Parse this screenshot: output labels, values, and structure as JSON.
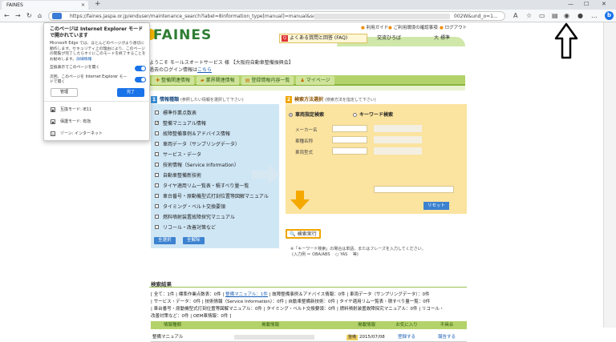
{
  "browser": {
    "tab_title": "FAINES",
    "tab_close": "✕",
    "new_tab": "+",
    "url": "https://faines.jaspa.or.jp/enduser/maintenance_search?label=8information_type[manual]=manual&select_",
    "url_tail": "002W&und_o=1...",
    "nav": {
      "back": "←",
      "forward": "→",
      "refresh": "↻",
      "home": "⌂"
    },
    "window": {
      "minimize": "—",
      "maximize": "☐",
      "close": "✕"
    },
    "edge_icon": "b"
  },
  "ie_popup": {
    "title": "このページは Internet Explorer モードで開かれています",
    "body": "Microsoft Edge では、ほとんどのページがより適切に動作します。セキュリティ上の理由により、このページの閲覧が完了したらすぐにこのモードを終了することをお勧めします。",
    "body_link": "詳細情報",
    "row1": "互換表示でこのページを開く",
    "row2": "次回、このページを Internet Explorer モードで開く",
    "manage_label": "管理",
    "done_label": "完了",
    "items": [
      {
        "label": "互換モード: IE11",
        "icon": "compat-icon"
      },
      {
        "label": "保護モード: 有効",
        "icon": "shield-icon"
      },
      {
        "label": "ゾーン: インターネット",
        "icon": "globe-icon"
      }
    ]
  },
  "site": {
    "logo": "FAINES",
    "top_links": [
      "利用ガイド",
      "ご利用環境の確認事項",
      "ログアウト"
    ],
    "faq": "よくある質問と回答 (FAQ)",
    "faq_icon": "Q",
    "koryu": "交流ひろば",
    "lang": "大",
    "lang2": "標準",
    "welcome": "ようこそ モールスオートサービス 様 【大阪府自動車整備振興会】",
    "login_prefix": "過去のログイン情報は",
    "login_link": "こちら",
    "nav_tabs": [
      "整備関連情報",
      "業界関連情報",
      "登録情報内容一覧",
      "マイページ"
    ]
  },
  "panel1": {
    "num": "1",
    "title": "情報種類",
    "sub": "(参照したい情報を選択して下さい)",
    "items": [
      {
        "label": "標準作業点数表",
        "checked": false
      },
      {
        "label": "整備マニュアル情報",
        "checked": true
      },
      {
        "label": "故障整備事例＆アドバイス情報",
        "checked": false
      },
      {
        "label": "車両データ（サンプリングデータ）",
        "checked": false
      },
      {
        "label": "サービス・データ",
        "checked": false
      },
      {
        "label": "技術情報（Service Information）",
        "checked": false
      },
      {
        "label": "自動車整備新技術",
        "checked": false
      },
      {
        "label": "タイヤ適用リム一覧表・積すべり量一覧",
        "checked": false
      },
      {
        "label": "車台番号・原動機型式打刻位置等図解マニュアル",
        "checked": false
      },
      {
        "label": "タイミング・ベルト交換要領",
        "checked": false
      },
      {
        "label": "燃料噴射装置故障探究マニュアル",
        "checked": false
      },
      {
        "label": "リコール・改善対策など",
        "checked": false
      }
    ],
    "select_all": "全選択",
    "deselect_all": "全解除"
  },
  "panel2": {
    "num": "2",
    "title": "検索方法選択",
    "sub": "(検索方法を指定して下さい)",
    "radio1": "車両指定検索",
    "radio2": "キーワード検索",
    "fields": [
      "メーカー名",
      "車種名称",
      "車両型式"
    ],
    "reset": "リセット"
  },
  "exec_label": "検索実行",
  "notes": [
    "※「キーワード検索」の場合は単語、またはフレーズを入力してください。",
    "(入力例 ＝ OBA/ABS 　○ YAS 　等)"
  ],
  "results": {
    "title": "検索結果",
    "line1_prefix": "[ 全て：1件 | 標準作業点数表：0件 | ",
    "line1_link": "整備マニュアル：1件",
    "line1_rest": " | 故障整備事例＆アドバイス情報：0件 | 車両データ（サンプリングデータ）：0件",
    "line2": "| サービス・データ：0件 | 技術情報（Service Information）：0件 | 自動車整備新技術：0件 | タイヤ適用リム一覧表・積すべり量一覧：0件",
    "line3": "| 車台番号・原動機型式打刻位置等図解マニュアル：0件 | タイミング・ベルト交換要領：0件 | 燃料噴射装置故障探究マニュアル：0件 | リコール・",
    "line4": "改善対策など：0件 | OEM車情報：0件 ]",
    "columns": [
      "情報種類",
      "掲載情報",
      "掲載情報",
      "お気に入り",
      "不具合"
    ],
    "row": {
      "type": "整備マニュアル",
      "tag": "整備",
      "date": "2015/07/08",
      "fav": "登録する",
      "bug": "報告する"
    }
  },
  "colors": {
    "green": "#b4d26a",
    "blue": "#3c82d0",
    "orange": "#f0a500",
    "panel_blue": "#cfe6f5",
    "panel_yellow": "#fbe3a0"
  }
}
